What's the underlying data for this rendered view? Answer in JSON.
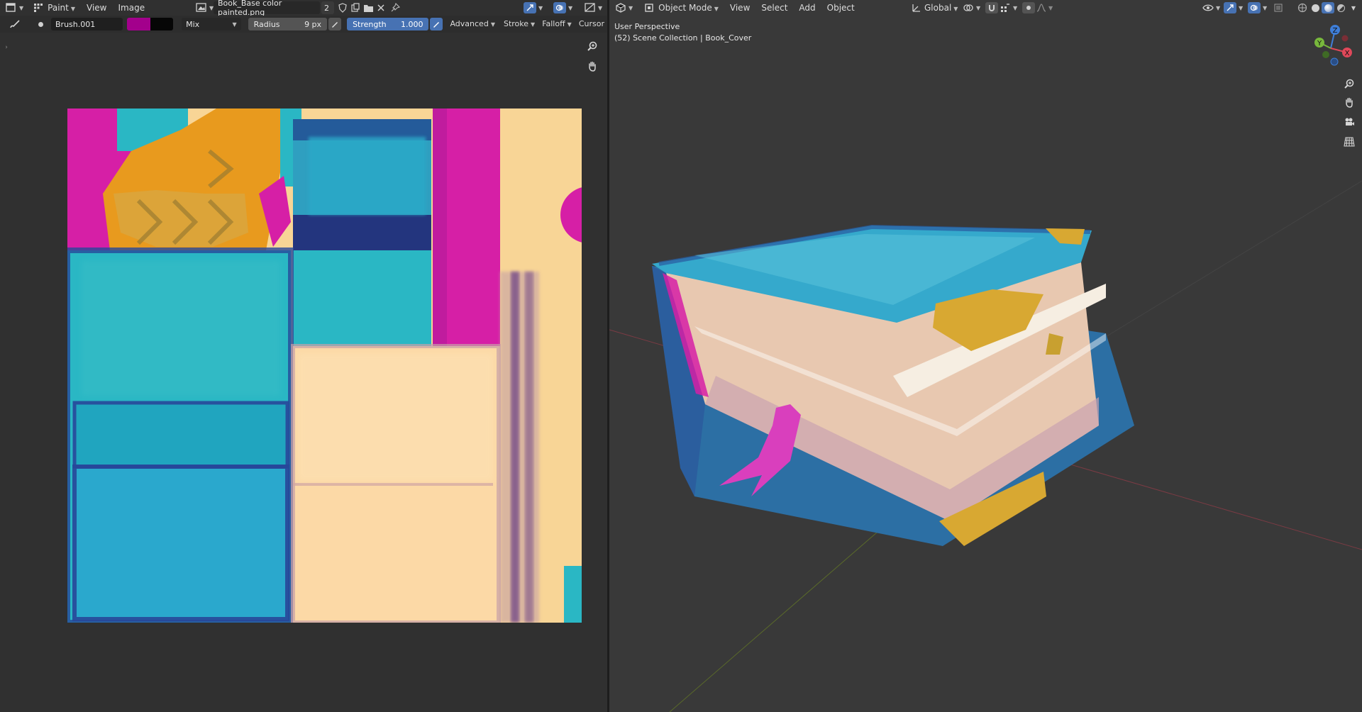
{
  "image_editor": {
    "mode_label": "Paint",
    "menu": [
      "View",
      "Image"
    ],
    "image_name": "Book_Base color painted.png",
    "users_count": "2",
    "toolbar": {
      "brush_name": "Brush.001",
      "primary_color": "#a3008c",
      "secondary_color": "#060606",
      "blend_mode": "Mix",
      "radius_label": "Radius",
      "radius_value": "9 px",
      "strength_label": "Strength",
      "strength_value": "1.000",
      "advanced_label": "Advanced",
      "stroke_label": "Stroke",
      "falloff_label": "Falloff",
      "cursor_label": "Cursor"
    }
  },
  "viewport": {
    "mode_label": "Object Mode",
    "menu": [
      "View",
      "Select",
      "Add",
      "Object"
    ],
    "orientation_label": "Global",
    "overlay_title": "User Perspective",
    "overlay_subtitle": "(52) Scene Collection | Book_Cover",
    "gizmo": {
      "z": "Z",
      "y": "Y",
      "x": "X"
    }
  },
  "colors": {
    "accent": "#4772b3",
    "cyan": "#2ab7c4",
    "magenta": "#d61fa6",
    "orange": "#e89a1e",
    "cream": "#f8d596",
    "x_axis": "#e0485a",
    "y_axis": "#78b83c",
    "z_axis": "#3e7ed8"
  }
}
